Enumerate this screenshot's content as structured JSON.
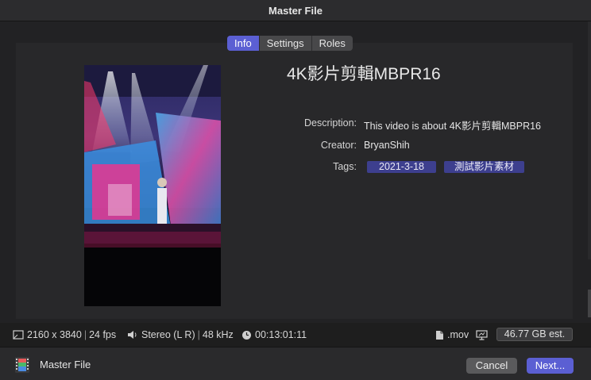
{
  "window": {
    "title": "Master File"
  },
  "tabs": [
    {
      "label": "Info",
      "active": true
    },
    {
      "label": "Settings",
      "active": false
    },
    {
      "label": "Roles",
      "active": false
    }
  ],
  "clip": {
    "title": "4K影片剪輯MBPR16",
    "description_label": "Description:",
    "description_value": "This video is about 4K影片剪輯MBPR16",
    "creator_label": "Creator:",
    "creator_value": "BryanShih",
    "tags_label": "Tags:",
    "tags": [
      "2021-3-18",
      "測試影片素材"
    ]
  },
  "status": {
    "resolution": "2160 x 3840",
    "fps": "24 fps",
    "audio": "Stereo (L R)",
    "sample_rate": "48 kHz",
    "duration": "00:13:01:11",
    "format": ".mov",
    "size_estimate": "46.77 GB est."
  },
  "footer": {
    "app_label": "Master File",
    "cancel_label": "Cancel",
    "next_label": "Next..."
  },
  "colors": {
    "accent": "#5b5fd3",
    "tag_bg": "#3d3f8e",
    "panel_bg": "#28282a"
  }
}
